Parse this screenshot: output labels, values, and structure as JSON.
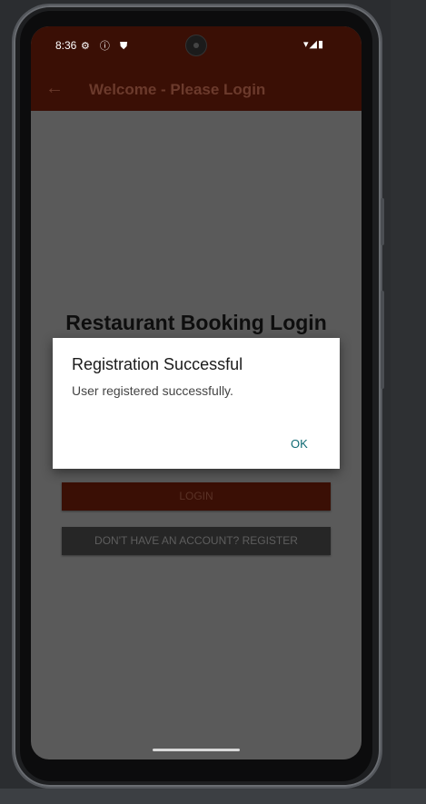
{
  "status_bar": {
    "time": "8:36",
    "left_icons": "⚙ ⓘ ⛊",
    "right_icons": "▾◢▮"
  },
  "app_bar": {
    "back_icon": "←",
    "title": "Welcome - Please Login"
  },
  "login_screen": {
    "heading": "Restaurant Booking Login",
    "login_button": "LOGIN",
    "register_button": "DON'T HAVE AN ACCOUNT? REGISTER"
  },
  "dialog": {
    "title": "Registration Successful",
    "message": "User registered successfully.",
    "ok_button": "OK"
  },
  "colors": {
    "app_bar": "#3a0f05",
    "dialog_accent": "#0f6a73"
  }
}
